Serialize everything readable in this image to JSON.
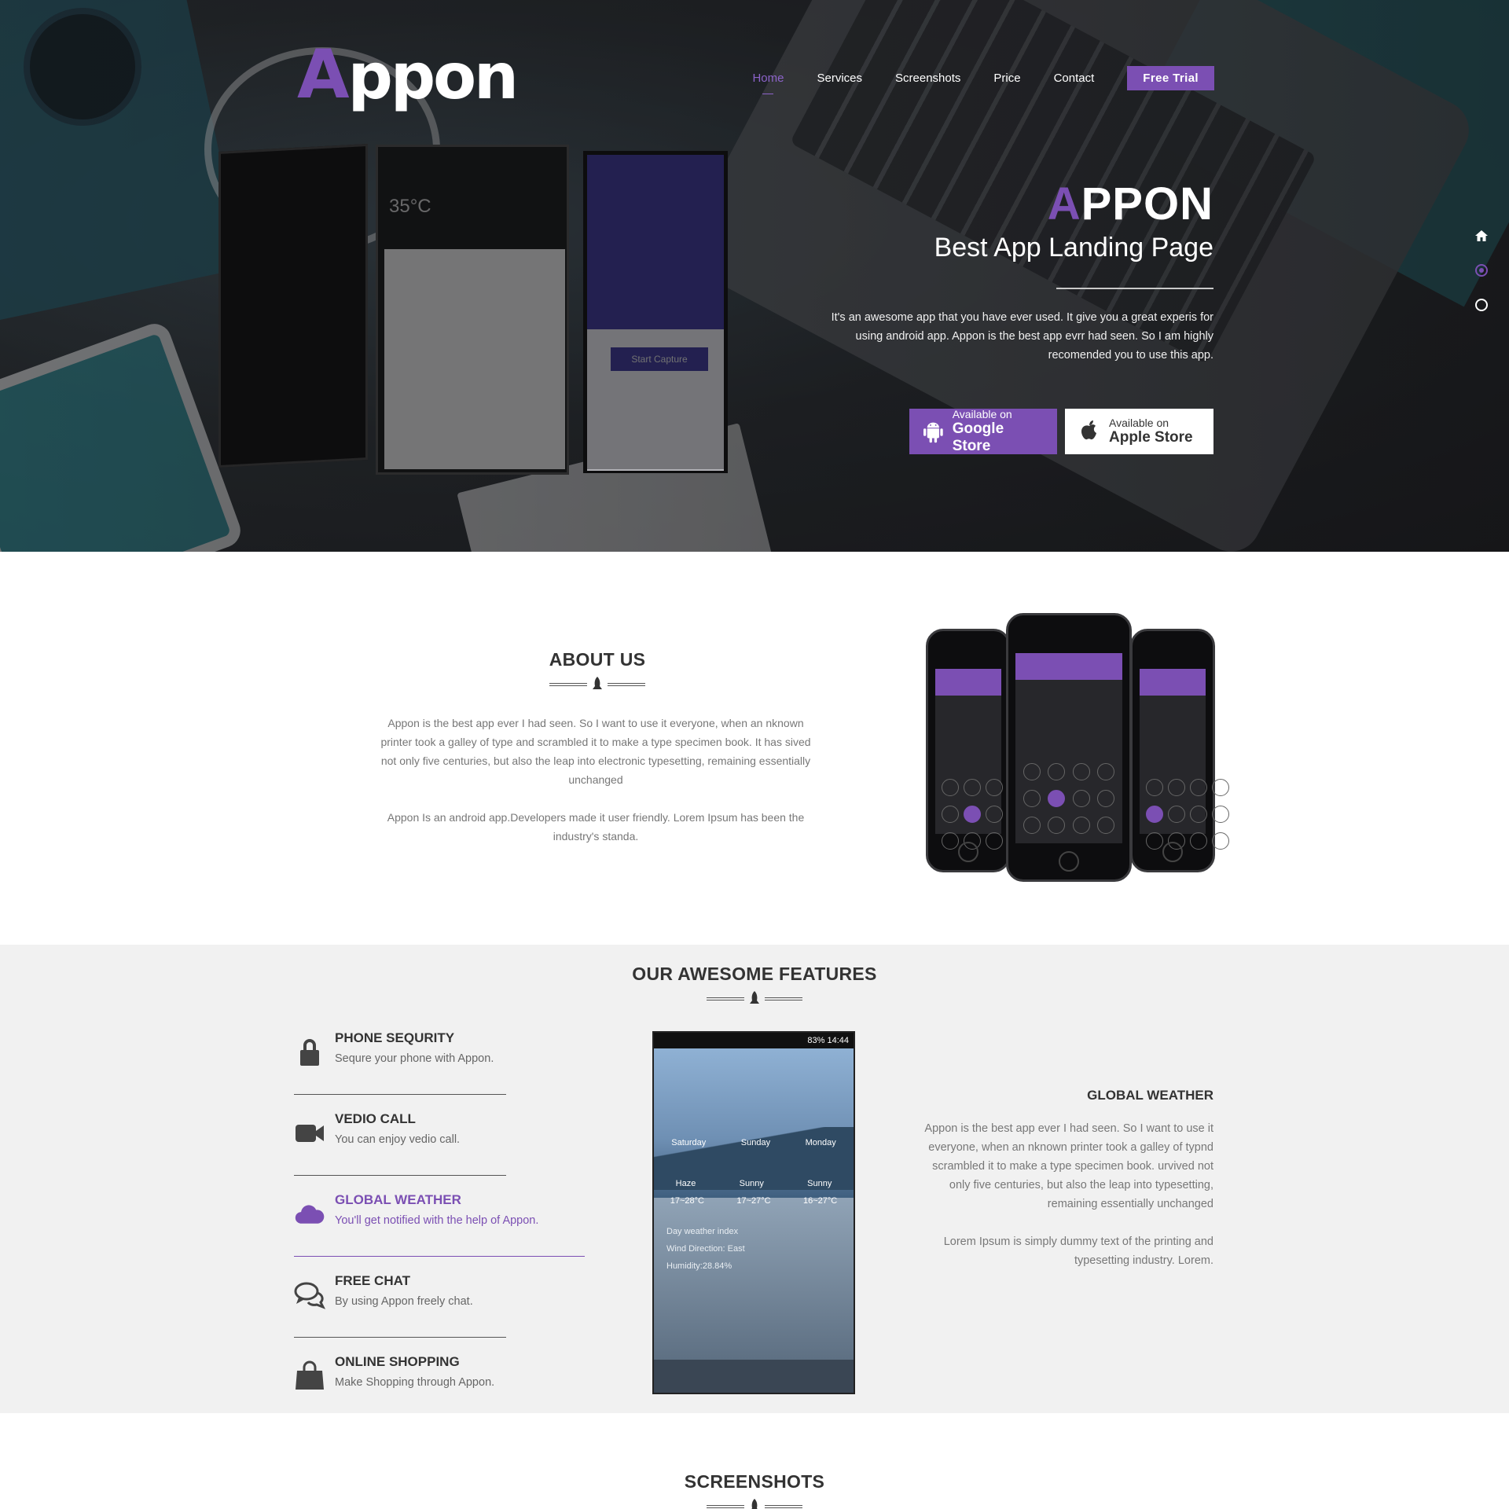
{
  "brand": {
    "logo_first": "A",
    "logo_rest": "ppon",
    "accent": "#7b4fb3"
  },
  "nav": {
    "items": [
      "Home",
      "Services",
      "Screenshots",
      "Price",
      "Contact"
    ],
    "active": "Home",
    "cta": "Free Trial"
  },
  "hero": {
    "title_first": "A",
    "title_rest": "PPON",
    "subtitle": "Best App Landing Page",
    "text": "It's an awesome app that you have ever used. It give you a great experis for using android app.  Appon is the best app evrr had seen. So I am highly recomended you to use this app.",
    "google": {
      "small": "Available on",
      "big": "Google Store"
    },
    "apple": {
      "small": "Available on",
      "big": "Apple Store"
    },
    "phone_weather": "35°C",
    "phone_capture": "Start Capture"
  },
  "about": {
    "title": "ABOUT US",
    "p1": "Appon is the best app ever I had seen. So I want to use it everyone, when an nknown printer took a galley of type and scrambled it to make a type specimen book. It has sived not only five centuries, but also the leap into electronic typesetting, remaining essentially unchanged",
    "p2": "Appon Is an android app.Developers made it user friendly. Lorem Ipsum has been the industry's standa."
  },
  "features": {
    "title": "OUR AWESOME FEATURES",
    "items": [
      {
        "title": "PHONE SEQURITY",
        "desc": "Sequre your phone with Appon.",
        "icon": "lock-icon"
      },
      {
        "title": "VEDIO CALL",
        "desc": "You can enjoy vedio call.",
        "icon": "video-camera-icon"
      },
      {
        "title": "GLOBAL WEATHER",
        "desc": "You'll get notified with the help of Appon.",
        "icon": "cloud-icon"
      },
      {
        "title": "FREE CHAT",
        "desc": "By using Appon freely chat.",
        "icon": "chat-icon"
      },
      {
        "title": "ONLINE SHOPPING",
        "desc": "Make Shopping through Appon.",
        "icon": "shopping-bag-icon"
      }
    ],
    "active_index": 2,
    "weather_phone": {
      "time": "83%  14:44",
      "days": [
        "Saturday",
        "Sunday",
        "Monday"
      ],
      "conditions": [
        "Haze",
        "Sunny",
        "Sunny"
      ],
      "temps": [
        "17~28°C",
        "17~27°C",
        "16~27°C"
      ],
      "index": "Day weather index",
      "wind": "Wind Direction: East",
      "humidity": "Humidity:28.84%"
    },
    "detail_title": "GLOBAL WEATHER",
    "detail_p1": "Appon is the best app ever I had seen. So I want to use it everyone, when an nknown printer took a galley of typnd scrambled it to make a type specimen book. urvived not only five centuries, but also the leap into typesetting, remaining essentially unchanged",
    "detail_p2": "Lorem Ipsum is simply dummy text of the printing and typesetting industry. Lorem."
  },
  "screenshots": {
    "title": "SCREENSHOTS"
  }
}
